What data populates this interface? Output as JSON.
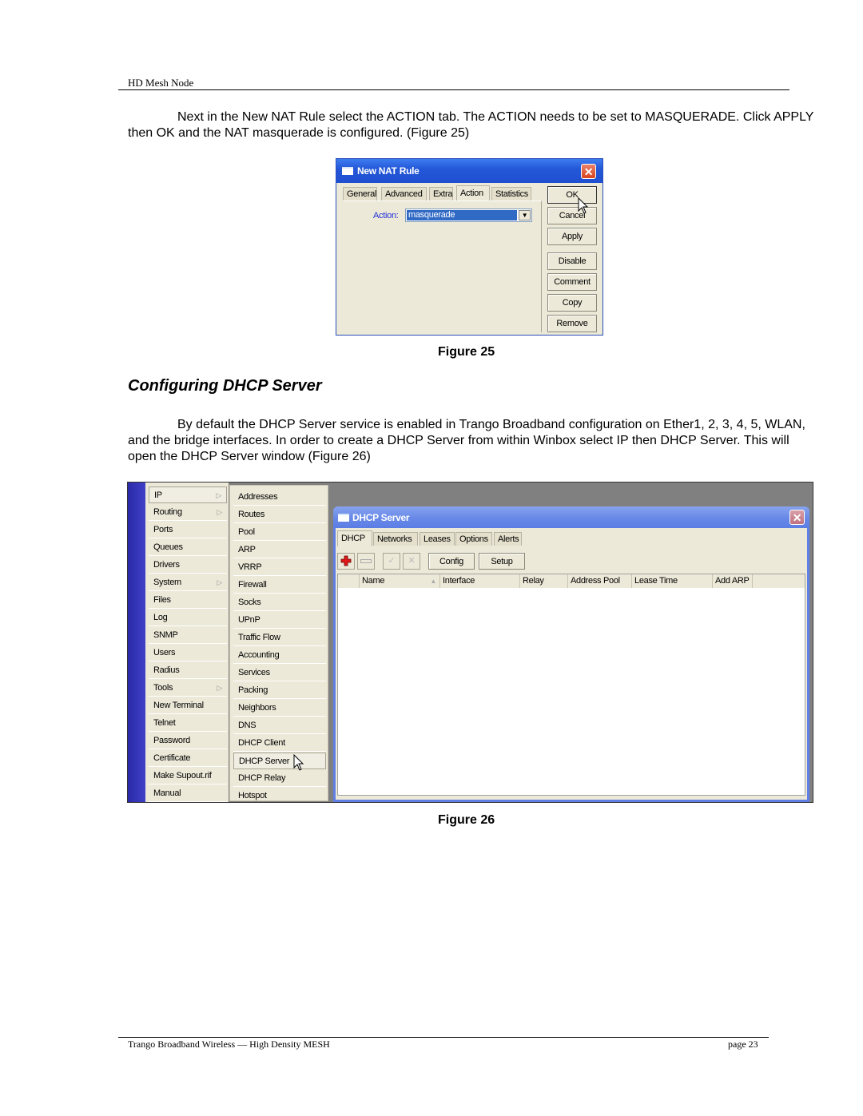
{
  "page_header": "HD Mesh Node",
  "intro_paragraph": "Next in the New NAT Rule select the ACTION tab. The ACTION needs to be set to MASQUERADE. Click APPLY then OK and the NAT masquerade is configured. (Figure 25)",
  "figure25": {
    "caption": "Figure 25",
    "window_title": "New NAT Rule",
    "tabs": [
      "General",
      "Advanced",
      "Extra",
      "Action",
      "Statistics"
    ],
    "active_tab": "Action",
    "action_label": "Action:",
    "action_value": "masquerade",
    "buttons": [
      "OK",
      "Cancel",
      "Apply",
      "Disable",
      "Comment",
      "Copy",
      "Remove"
    ]
  },
  "section_title": "Configuring DHCP Server",
  "dhcp_paragraph": "By default the DHCP Server service is enabled in Trango Broadband configuration on Ether1, 2, 3, 4, 5, WLAN, and the bridge interfaces. In order to create a DHCP Server from within Winbox select IP then DHCP Server. This will open the DHCP Server window (Figure 26)",
  "figure26": {
    "caption": "Figure 26",
    "main_menu": [
      {
        "label": "IP",
        "submenu": true
      },
      {
        "label": "Routing",
        "submenu": true
      },
      {
        "label": "Ports",
        "submenu": false
      },
      {
        "label": "Queues",
        "submenu": false
      },
      {
        "label": "Drivers",
        "submenu": false
      },
      {
        "label": "System",
        "submenu": true
      },
      {
        "label": "Files",
        "submenu": false
      },
      {
        "label": "Log",
        "submenu": false
      },
      {
        "label": "SNMP",
        "submenu": false
      },
      {
        "label": "Users",
        "submenu": false
      },
      {
        "label": "Radius",
        "submenu": false
      },
      {
        "label": "Tools",
        "submenu": true
      },
      {
        "label": "New Terminal",
        "submenu": false
      },
      {
        "label": "Telnet",
        "submenu": false
      },
      {
        "label": "Password",
        "submenu": false
      },
      {
        "label": "Certificate",
        "submenu": false
      },
      {
        "label": "Make Supout.rif",
        "submenu": false
      },
      {
        "label": "Manual",
        "submenu": false
      }
    ],
    "ip_submenu": [
      "Addresses",
      "Routes",
      "Pool",
      "ARP",
      "VRRP",
      "Firewall",
      "Socks",
      "UPnP",
      "Traffic Flow",
      "Accounting",
      "Services",
      "Packing",
      "Neighbors",
      "DNS",
      "DHCP Client",
      "DHCP Server",
      "DHCP Relay",
      "Hotspot"
    ],
    "selected_submenu": "DHCP Server",
    "window_title": "DHCP Server",
    "tabs": [
      "DHCP",
      "Networks",
      "Leases",
      "Options",
      "Alerts"
    ],
    "active_tab": "DHCP",
    "toolbar_buttons": [
      "Config",
      "Setup"
    ],
    "columns": [
      "Name",
      "Interface",
      "Relay",
      "Address Pool",
      "Lease Time",
      "Add ARP"
    ]
  },
  "footer_left": "Trango Broadband Wireless — High Density MESH",
  "footer_right": "page 23"
}
